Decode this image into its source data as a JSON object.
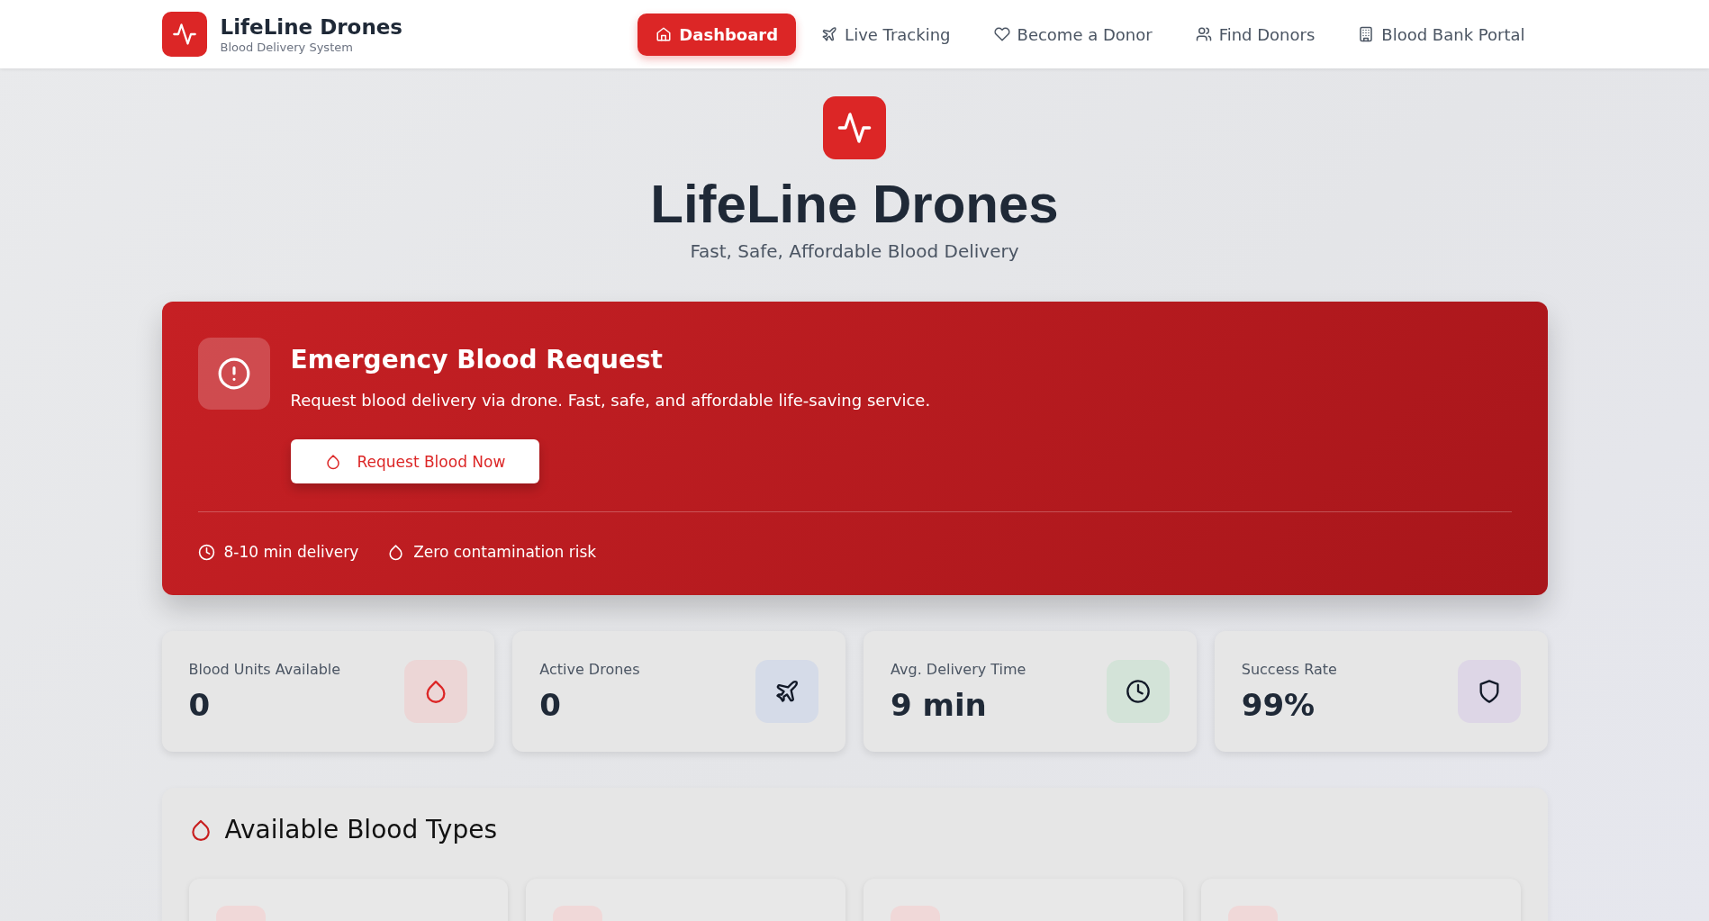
{
  "brand": {
    "name": "LifeLine Drones",
    "tagline": "Blood Delivery System"
  },
  "nav": [
    {
      "label": "Dashboard",
      "selected": true
    },
    {
      "label": "Live Tracking",
      "selected": false
    },
    {
      "label": "Become a Donor",
      "selected": false
    },
    {
      "label": "Find Donors",
      "selected": false
    },
    {
      "label": "Blood Bank Portal",
      "selected": false
    }
  ],
  "hero": {
    "title": "LifeLine Drones",
    "subtitle": "Fast, Safe, Affordable Blood Delivery"
  },
  "emergency": {
    "title": "Emergency Blood Request",
    "text": "Request blood delivery via drone. Fast, safe, and affordable life-saving service.",
    "button": "Request Blood Now",
    "features": [
      "8-10 min delivery",
      "Zero contamination risk"
    ]
  },
  "stats": [
    {
      "label": "Blood Units Available",
      "value": "0",
      "color": "#ecd6d6"
    },
    {
      "label": "Active Drones",
      "value": "0",
      "color": "#d5dbe8"
    },
    {
      "label": "Avg. Delivery Time",
      "value": "9 min",
      "color": "#d3e3d8"
    },
    {
      "label": "Success Rate",
      "value": "99%",
      "color": "#ddd6e6"
    }
  ],
  "blood_types": {
    "title": "Available Blood Types"
  }
}
